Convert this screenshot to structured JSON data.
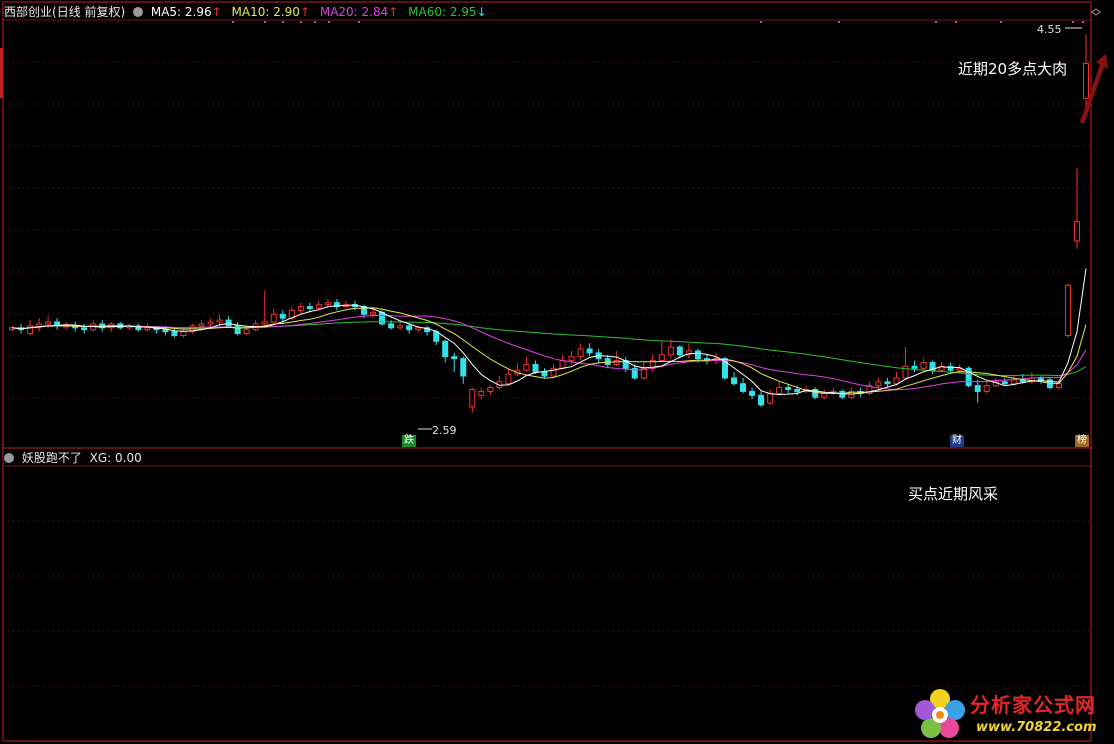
{
  "header": {
    "stock_name": "西部创业",
    "period": "(日线 前复权)",
    "ma5_label": "MA5: 2.96",
    "ma10_label": "MA10: 2.90",
    "ma20_label": "MA20: 2.84",
    "ma60_label": "MA60: 2.95",
    "up_arrow": "↑",
    "down_arrow": "↓"
  },
  "sub_header": {
    "indicator_name": "妖股跑不了",
    "xg_label": "XG: 0.00"
  },
  "annotations": {
    "top_annotation": "近期20多点大肉",
    "bottom_annotation": "买点近期风采",
    "high_price": "4.55",
    "low_price": "2.59",
    "marker_die": "跌",
    "marker_cai": "财",
    "marker_bang": "榜"
  },
  "logo": {
    "brand": "分析家公式网",
    "url": "www.70822.com"
  },
  "colors": {
    "background": "#000000",
    "up": "#f03030",
    "down": "#34e0e8",
    "ma5": "#ffffff",
    "ma10": "#e8e854",
    "ma20": "#e040e0",
    "ma60": "#30c030",
    "grid": "#7a1010",
    "frame": "#c02020",
    "arrow": "#8b1010"
  },
  "chart_data": {
    "type": "candlestick",
    "ylim": [
      2.5,
      4.6
    ],
    "last_ma": {
      "ma5": 2.96,
      "ma10": 2.9,
      "ma20": 2.84,
      "ma60": 2.95
    },
    "price_labels": {
      "high": 4.55,
      "low": 2.59
    },
    "candles": [
      {
        "o": 3.02,
        "c": 3.03,
        "h": 3.04,
        "l": 3.01
      },
      {
        "o": 3.03,
        "c": 3.02,
        "h": 3.05,
        "l": 3.0
      },
      {
        "o": 3.0,
        "c": 3.04,
        "h": 3.07,
        "l": 2.99
      },
      {
        "o": 3.03,
        "c": 3.05,
        "h": 3.08,
        "l": 3.01
      },
      {
        "o": 3.05,
        "c": 3.06,
        "h": 3.09,
        "l": 3.03
      },
      {
        "o": 3.06,
        "c": 3.04,
        "h": 3.08,
        "l": 3.02
      },
      {
        "o": 3.04,
        "c": 3.04,
        "h": 3.06,
        "l": 3.02
      },
      {
        "o": 3.04,
        "c": 3.03,
        "h": 3.06,
        "l": 3.01
      },
      {
        "o": 3.03,
        "c": 3.02,
        "h": 3.05,
        "l": 3.0
      },
      {
        "o": 3.02,
        "c": 3.05,
        "h": 3.07,
        "l": 3.01
      },
      {
        "o": 3.05,
        "c": 3.03,
        "h": 3.07,
        "l": 3.01
      },
      {
        "o": 3.03,
        "c": 3.05,
        "h": 3.06,
        "l": 3.01
      },
      {
        "o": 3.05,
        "c": 3.03,
        "h": 3.06,
        "l": 3.02
      },
      {
        "o": 3.03,
        "c": 3.04,
        "h": 3.05,
        "l": 3.02
      },
      {
        "o": 3.04,
        "c": 3.02,
        "h": 3.05,
        "l": 3.01
      },
      {
        "o": 3.02,
        "c": 3.03,
        "h": 3.05,
        "l": 3.01
      },
      {
        "o": 3.03,
        "c": 3.02,
        "h": 3.04,
        "l": 3.0
      },
      {
        "o": 3.02,
        "c": 3.01,
        "h": 3.04,
        "l": 2.99
      },
      {
        "o": 3.01,
        "c": 2.99,
        "h": 3.03,
        "l": 2.98
      },
      {
        "o": 2.99,
        "c": 3.01,
        "h": 3.02,
        "l": 2.98
      },
      {
        "o": 3.01,
        "c": 3.04,
        "h": 3.05,
        "l": 3.0
      },
      {
        "o": 3.04,
        "c": 3.05,
        "h": 3.07,
        "l": 3.02
      },
      {
        "o": 3.05,
        "c": 3.06,
        "h": 3.08,
        "l": 3.03
      },
      {
        "o": 3.06,
        "c": 3.07,
        "h": 3.1,
        "l": 3.04
      },
      {
        "o": 3.07,
        "c": 3.04,
        "h": 3.09,
        "l": 3.03
      },
      {
        "o": 3.04,
        "c": 3.0,
        "h": 3.06,
        "l": 2.99
      },
      {
        "o": 3.0,
        "c": 3.02,
        "h": 3.04,
        "l": 2.99
      },
      {
        "o": 3.02,
        "c": 3.05,
        "h": 3.07,
        "l": 3.01
      },
      {
        "o": 3.05,
        "c": 3.06,
        "h": 3.22,
        "l": 3.04
      },
      {
        "o": 3.06,
        "c": 3.1,
        "h": 3.13,
        "l": 3.05
      },
      {
        "o": 3.1,
        "c": 3.08,
        "h": 3.12,
        "l": 3.05
      },
      {
        "o": 3.08,
        "c": 3.12,
        "h": 3.14,
        "l": 3.07
      },
      {
        "o": 3.12,
        "c": 3.14,
        "h": 3.16,
        "l": 3.1
      },
      {
        "o": 3.14,
        "c": 3.13,
        "h": 3.16,
        "l": 3.11
      },
      {
        "o": 3.13,
        "c": 3.15,
        "h": 3.17,
        "l": 3.12
      },
      {
        "o": 3.15,
        "c": 3.16,
        "h": 3.18,
        "l": 3.13
      },
      {
        "o": 3.16,
        "c": 3.14,
        "h": 3.18,
        "l": 3.12
      },
      {
        "o": 3.14,
        "c": 3.15,
        "h": 3.17,
        "l": 3.13
      },
      {
        "o": 3.15,
        "c": 3.14,
        "h": 3.17,
        "l": 3.12
      },
      {
        "o": 3.14,
        "c": 3.1,
        "h": 3.15,
        "l": 3.08
      },
      {
        "o": 3.1,
        "c": 3.11,
        "h": 3.13,
        "l": 3.08
      },
      {
        "o": 3.11,
        "c": 3.05,
        "h": 3.12,
        "l": 3.04
      },
      {
        "o": 3.05,
        "c": 3.03,
        "h": 3.07,
        "l": 3.02
      },
      {
        "o": 3.03,
        "c": 3.04,
        "h": 3.06,
        "l": 3.02
      },
      {
        "o": 3.04,
        "c": 3.02,
        "h": 3.05,
        "l": 3.0
      },
      {
        "o": 3.02,
        "c": 3.03,
        "h": 3.04,
        "l": 3.01
      },
      {
        "o": 3.03,
        "c": 3.01,
        "h": 3.04,
        "l": 2.99
      },
      {
        "o": 3.01,
        "c": 2.96,
        "h": 3.02,
        "l": 2.94
      },
      {
        "o": 2.96,
        "c": 2.88,
        "h": 2.97,
        "l": 2.85
      },
      {
        "o": 2.88,
        "c": 2.87,
        "h": 2.9,
        "l": 2.8
      },
      {
        "o": 2.87,
        "c": 2.78,
        "h": 2.88,
        "l": 2.74
      },
      {
        "o": 2.62,
        "c": 2.71,
        "h": 2.72,
        "l": 2.59
      },
      {
        "o": 2.68,
        "c": 2.7,
        "h": 2.72,
        "l": 2.66
      },
      {
        "o": 2.7,
        "c": 2.72,
        "h": 2.73,
        "l": 2.68
      },
      {
        "o": 2.72,
        "c": 2.75,
        "h": 2.78,
        "l": 2.71
      },
      {
        "o": 2.74,
        "c": 2.79,
        "h": 2.82,
        "l": 2.73
      },
      {
        "o": 2.79,
        "c": 2.81,
        "h": 2.85,
        "l": 2.78
      },
      {
        "o": 2.81,
        "c": 2.84,
        "h": 2.88,
        "l": 2.8
      },
      {
        "o": 2.84,
        "c": 2.8,
        "h": 2.86,
        "l": 2.79
      },
      {
        "o": 2.8,
        "c": 2.78,
        "h": 2.82,
        "l": 2.77
      },
      {
        "o": 2.78,
        "c": 2.82,
        "h": 2.84,
        "l": 2.77
      },
      {
        "o": 2.82,
        "c": 2.86,
        "h": 2.89,
        "l": 2.81
      },
      {
        "o": 2.86,
        "c": 2.88,
        "h": 2.91,
        "l": 2.84
      },
      {
        "o": 2.88,
        "c": 2.92,
        "h": 2.95,
        "l": 2.86
      },
      {
        "o": 2.92,
        "c": 2.9,
        "h": 2.95,
        "l": 2.88
      },
      {
        "o": 2.9,
        "c": 2.87,
        "h": 2.92,
        "l": 2.85
      },
      {
        "o": 2.87,
        "c": 2.84,
        "h": 2.89,
        "l": 2.82
      },
      {
        "o": 2.84,
        "c": 2.86,
        "h": 2.91,
        "l": 2.83
      },
      {
        "o": 2.86,
        "c": 2.82,
        "h": 2.88,
        "l": 2.8
      },
      {
        "o": 2.82,
        "c": 2.77,
        "h": 2.84,
        "l": 2.76
      },
      {
        "o": 2.77,
        "c": 2.82,
        "h": 2.85,
        "l": 2.76
      },
      {
        "o": 2.82,
        "c": 2.86,
        "h": 2.89,
        "l": 2.8
      },
      {
        "o": 2.86,
        "c": 2.89,
        "h": 2.96,
        "l": 2.85
      },
      {
        "o": 2.89,
        "c": 2.93,
        "h": 2.97,
        "l": 2.87
      },
      {
        "o": 2.93,
        "c": 2.89,
        "h": 2.94,
        "l": 2.87
      },
      {
        "o": 2.89,
        "c": 2.91,
        "h": 2.95,
        "l": 2.87
      },
      {
        "o": 2.91,
        "c": 2.87,
        "h": 2.92,
        "l": 2.85
      },
      {
        "o": 2.87,
        "c": 2.86,
        "h": 2.89,
        "l": 2.84
      },
      {
        "o": 2.86,
        "c": 2.87,
        "h": 2.9,
        "l": 2.84
      },
      {
        "o": 2.87,
        "c": 2.77,
        "h": 2.88,
        "l": 2.76
      },
      {
        "o": 2.77,
        "c": 2.74,
        "h": 2.8,
        "l": 2.73
      },
      {
        "o": 2.74,
        "c": 2.7,
        "h": 2.77,
        "l": 2.69
      },
      {
        "o": 2.7,
        "c": 2.68,
        "h": 2.72,
        "l": 2.66
      },
      {
        "o": 2.68,
        "c": 2.63,
        "h": 2.7,
        "l": 2.62
      },
      {
        "o": 2.64,
        "c": 2.69,
        "h": 2.71,
        "l": 2.63
      },
      {
        "o": 2.69,
        "c": 2.72,
        "h": 2.75,
        "l": 2.68
      },
      {
        "o": 2.72,
        "c": 2.71,
        "h": 2.74,
        "l": 2.69
      },
      {
        "o": 2.71,
        "c": 2.7,
        "h": 2.73,
        "l": 2.68
      },
      {
        "o": 2.7,
        "c": 2.71,
        "h": 2.73,
        "l": 2.69
      },
      {
        "o": 2.71,
        "c": 2.67,
        "h": 2.72,
        "l": 2.66
      },
      {
        "o": 2.67,
        "c": 2.69,
        "h": 2.71,
        "l": 2.66
      },
      {
        "o": 2.69,
        "c": 2.7,
        "h": 2.72,
        "l": 2.68
      },
      {
        "o": 2.7,
        "c": 2.67,
        "h": 2.71,
        "l": 2.66
      },
      {
        "o": 2.67,
        "c": 2.7,
        "h": 2.72,
        "l": 2.66
      },
      {
        "o": 2.7,
        "c": 2.69,
        "h": 2.72,
        "l": 2.67
      },
      {
        "o": 2.69,
        "c": 2.73,
        "h": 2.75,
        "l": 2.68
      },
      {
        "o": 2.73,
        "c": 2.75,
        "h": 2.77,
        "l": 2.71
      },
      {
        "o": 2.75,
        "c": 2.74,
        "h": 2.77,
        "l": 2.72
      },
      {
        "o": 2.74,
        "c": 2.77,
        "h": 2.8,
        "l": 2.73
      },
      {
        "o": 2.77,
        "c": 2.83,
        "h": 2.93,
        "l": 2.76
      },
      {
        "o": 2.83,
        "c": 2.82,
        "h": 2.86,
        "l": 2.8
      },
      {
        "o": 2.82,
        "c": 2.85,
        "h": 2.87,
        "l": 2.81
      },
      {
        "o": 2.85,
        "c": 2.81,
        "h": 2.86,
        "l": 2.79
      },
      {
        "o": 2.81,
        "c": 2.83,
        "h": 2.85,
        "l": 2.8
      },
      {
        "o": 2.83,
        "c": 2.81,
        "h": 2.85,
        "l": 2.8
      },
      {
        "o": 2.81,
        "c": 2.82,
        "h": 2.84,
        "l": 2.8
      },
      {
        "o": 2.82,
        "c": 2.73,
        "h": 2.83,
        "l": 2.72
      },
      {
        "o": 2.73,
        "c": 2.7,
        "h": 2.76,
        "l": 2.64
      },
      {
        "o": 2.7,
        "c": 2.73,
        "h": 2.75,
        "l": 2.69
      },
      {
        "o": 2.73,
        "c": 2.75,
        "h": 2.77,
        "l": 2.72
      },
      {
        "o": 2.75,
        "c": 2.74,
        "h": 2.77,
        "l": 2.73
      },
      {
        "o": 2.74,
        "c": 2.76,
        "h": 2.78,
        "l": 2.73
      },
      {
        "o": 2.76,
        "c": 2.75,
        "h": 2.79,
        "l": 2.74
      },
      {
        "o": 2.75,
        "c": 2.77,
        "h": 2.8,
        "l": 2.74
      },
      {
        "o": 2.77,
        "c": 2.76,
        "h": 2.78,
        "l": 2.74
      },
      {
        "o": 2.76,
        "c": 2.72,
        "h": 2.77,
        "l": 2.71
      },
      {
        "o": 2.72,
        "c": 2.74,
        "h": 2.76,
        "l": 2.71
      },
      {
        "o": 2.99,
        "c": 3.25,
        "h": 3.26,
        "l": 2.98
      },
      {
        "o": 3.48,
        "c": 3.58,
        "h": 3.86,
        "l": 3.44
      },
      {
        "o": 4.22,
        "c": 4.4,
        "h": 4.55,
        "l": 4.18
      }
    ],
    "indicator": {
      "name": "妖股跑不了",
      "xg_value": 0.0,
      "signal_index": 126,
      "signal_value": 1.0
    }
  }
}
